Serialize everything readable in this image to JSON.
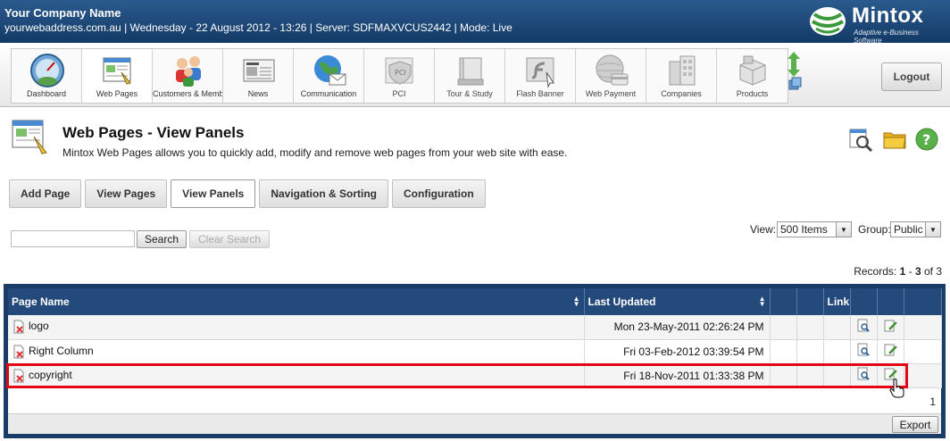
{
  "header": {
    "company": "Your Company Name",
    "info": "yourwebaddress.com.au | Wednesday - 22 August 2012 - 13:26 | Server: SDFMAXVCUS2442 | Mode: Live",
    "brand_name": "Mintox",
    "brand_tag": "Adaptive e-Business Software"
  },
  "toolbar": {
    "items": [
      {
        "label": "Dashboard"
      },
      {
        "label": "Web Pages"
      },
      {
        "label": "Customers & Members"
      },
      {
        "label": "News"
      },
      {
        "label": "Communication"
      },
      {
        "label": "PCI"
      },
      {
        "label": "Tour & Study"
      },
      {
        "label": "Flash Banner"
      },
      {
        "label": "Web Payment"
      },
      {
        "label": "Companies"
      },
      {
        "label": "Products"
      }
    ],
    "logout_label": "Logout"
  },
  "page": {
    "title": "Web Pages - View Panels",
    "subtitle": "Mintox Web Pages allows you to quickly add, modify and remove web pages from your web site with ease."
  },
  "subtabs": [
    {
      "label": "Add Page"
    },
    {
      "label": "View Pages"
    },
    {
      "label": "View Panels"
    },
    {
      "label": "Navigation & Sorting"
    },
    {
      "label": "Configuration"
    }
  ],
  "search": {
    "value": "",
    "button": "Search",
    "clear_button": "Clear Search"
  },
  "filters": {
    "view_label": "View:",
    "view_value": "500 Items",
    "group_label": "Group:",
    "group_value": "Public"
  },
  "records": {
    "label": "Records:",
    "from": "1",
    "sep": "-",
    "to": "3",
    "of": "of 3"
  },
  "table": {
    "headers": {
      "page_name": "Page Name",
      "last_updated": "Last Updated",
      "link": "Link"
    },
    "rows": [
      {
        "name": "logo",
        "updated": "Mon 23-May-2011 02:26:24 PM"
      },
      {
        "name": "Right Column",
        "updated": "Fri 03-Feb-2012 03:39:54 PM"
      },
      {
        "name": "copyright",
        "updated": "Fri 18-Nov-2011 01:33:38 PM"
      }
    ],
    "page": "1",
    "export_label": "Export"
  },
  "colors": {
    "header_bg": "#1f4a7a",
    "grid_bg": "#1a3c66",
    "highlight": "#e30613"
  }
}
